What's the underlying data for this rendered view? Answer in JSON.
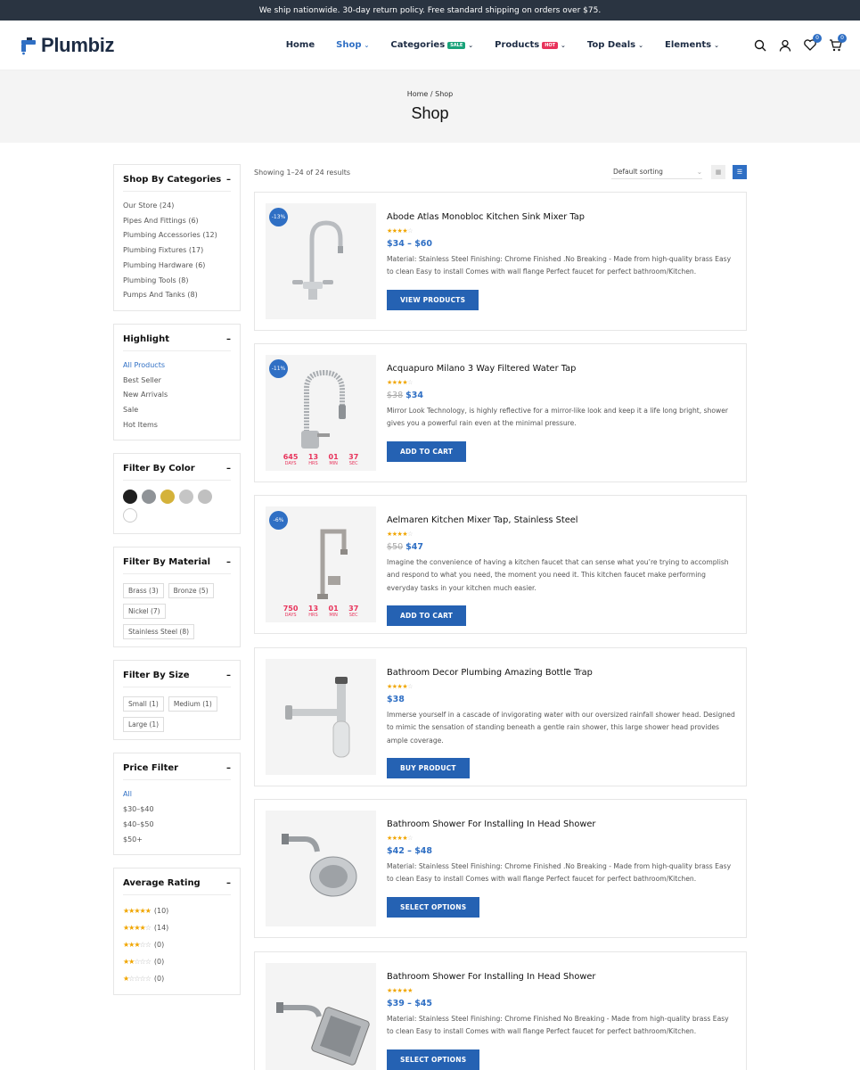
{
  "topbar": {
    "text": "We ship nationwide. 30-day return policy. Free standard shipping on orders over $75."
  },
  "logo": {
    "text": "Plumbiz"
  },
  "nav": [
    {
      "label": "Home",
      "active": false,
      "caret": false
    },
    {
      "label": "Shop",
      "active": true,
      "caret": true
    },
    {
      "label": "Categories",
      "badge": "SALE",
      "badge_color": "#1aa37a",
      "caret": true
    },
    {
      "label": "Products",
      "badge": "HOT",
      "badge_color": "#e8335b",
      "caret": true
    },
    {
      "label": "Top Deals",
      "caret": true
    },
    {
      "label": "Elements",
      "caret": true
    }
  ],
  "header_icons": {
    "wishlist_count": "0",
    "cart_count": "0"
  },
  "hero": {
    "breadcrumb_home": "Home",
    "breadcrumb_sep": "/",
    "breadcrumb_current": "Shop",
    "title": "Shop"
  },
  "sidebar": {
    "categories": {
      "title": "Shop By Categories",
      "items": [
        "Our Store (24)",
        "Pipes And Fittings (6)",
        "Plumbing Accessories (12)",
        "Plumbing Fixtures (17)",
        "Plumbing Hardware (6)",
        "Plumbing Tools (8)",
        "Pumps And Tanks (8)"
      ]
    },
    "highlight": {
      "title": "Highlight",
      "items": [
        "All Products",
        "Best Seller",
        "New Arrivals",
        "Sale",
        "Hot Items"
      ],
      "active": 0
    },
    "color": {
      "title": "Filter By Color",
      "swatches": [
        "#1f1f1f",
        "#8f9397",
        "#d4b23a",
        "#c5c5c5",
        "#c0c0c0",
        "#ffffff"
      ]
    },
    "material": {
      "title": "Filter By Material",
      "tags": [
        "Brass (3)",
        "Bronze (5)",
        "Nickel (7)",
        "Stainless Steel (8)"
      ]
    },
    "size": {
      "title": "Filter By Size",
      "tags": [
        "Small (1)",
        "Medium (1)",
        "Large (1)"
      ]
    },
    "price": {
      "title": "Price Filter",
      "items": [
        "All",
        "$30–$40",
        "$40–$50",
        "$50+"
      ],
      "active": 0
    },
    "rating": {
      "title": "Average Rating",
      "rows": [
        {
          "stars": 5,
          "count": "(10)"
        },
        {
          "stars": 4,
          "count": "(14)"
        },
        {
          "stars": 3,
          "count": "(0)"
        },
        {
          "stars": 2,
          "count": "(0)"
        },
        {
          "stars": 1,
          "count": "(0)"
        }
      ]
    },
    "minus_glyph": "–"
  },
  "toolbar": {
    "results": "Showing 1–24 of 24 results",
    "sort": "Default sorting"
  },
  "products": [
    {
      "title": "Abode Atlas Monobloc Kitchen Sink Mixer Tap",
      "discount": "-13%",
      "rating": 4,
      "old_price": "",
      "price": "$34 – $60",
      "desc": "Material: Stainless Steel Finishing: Chrome Finished .No Breaking - Made from high-quality brass Easy to clean Easy to install Comes with wall flange Perfect faucet for perfect bathroom/Kitchen.",
      "button": "VIEW PRODUCTS",
      "image": "faucet-monobloc"
    },
    {
      "title": "Acquapuro Milano 3 Way Filtered Water Tap",
      "discount": "-11%",
      "rating": 4,
      "old_price": "$38",
      "price": "$34",
      "desc": "Mirror Look Technology, is highly reflective for a mirror-like look and keep it a life long bright, shower gives you a powerful rain even at the minimal pressure.",
      "button": "ADD TO CART",
      "image": "faucet-spring",
      "countdown": [
        {
          "v": "645",
          "l": "DAYS"
        },
        {
          "v": "13",
          "l": "HRS"
        },
        {
          "v": "01",
          "l": "MIN"
        },
        {
          "v": "37",
          "l": "SEC"
        }
      ]
    },
    {
      "title": "Aelmaren Kitchen Mixer Tap, Stainless Steel",
      "discount": "-6%",
      "rating": 4,
      "old_price": "$50",
      "price": "$47",
      "desc": "Imagine the convenience of having a kitchen faucet that can sense what you’re trying to accomplish and respond to what you need, the moment you need it. This kitchen faucet make performing everyday tasks in your kitchen much easier.",
      "button": "ADD TO CART",
      "image": "faucet-square",
      "countdown": [
        {
          "v": "750",
          "l": "DAYS"
        },
        {
          "v": "13",
          "l": "HRS"
        },
        {
          "v": "01",
          "l": "MIN"
        },
        {
          "v": "37",
          "l": "SEC"
        }
      ]
    },
    {
      "title": "Bathroom Decor Plumbing Amazing Bottle Trap",
      "discount": "",
      "rating": 4,
      "old_price": "",
      "price": "$38",
      "desc": "Immerse yourself in a cascade of invigorating water with our oversized rainfall shower head. Designed to mimic the sensation of standing beneath a gentle rain shower, this large shower head provides ample coverage.",
      "button": "BUY PRODUCT",
      "image": "bottle-trap"
    },
    {
      "title": "Bathroom Shower For Installing In Head Shower",
      "discount": "",
      "rating": 4,
      "old_price": "",
      "price": "$42 – $48",
      "desc": "Material: Stainless Steel Finishing: Chrome Finished .No Breaking - Made from high-quality brass Easy to clean Easy to install Comes with wall flange Perfect faucet for perfect bathroom/Kitchen.",
      "button": "SELECT OPTIONS",
      "image": "shower-round"
    },
    {
      "title": "Bathroom Shower For Installing In Head Shower",
      "discount": "",
      "rating": 5,
      "old_price": "",
      "price": "$39 – $45",
      "desc": "Material: Stainless Steel Finishing: Chrome Finished No Breaking - Made from high-quality brass Easy to clean Easy to install Comes with wall flange Perfect faucet for perfect bathroom/Kitchen.",
      "button": "SELECT OPTIONS",
      "image": "shower-square"
    }
  ],
  "colors": {
    "accent": "#2f6fc4",
    "button": "#2562b3",
    "topbar": "#2a3441",
    "star": "#f0a500",
    "countdown": "#e8335b"
  }
}
